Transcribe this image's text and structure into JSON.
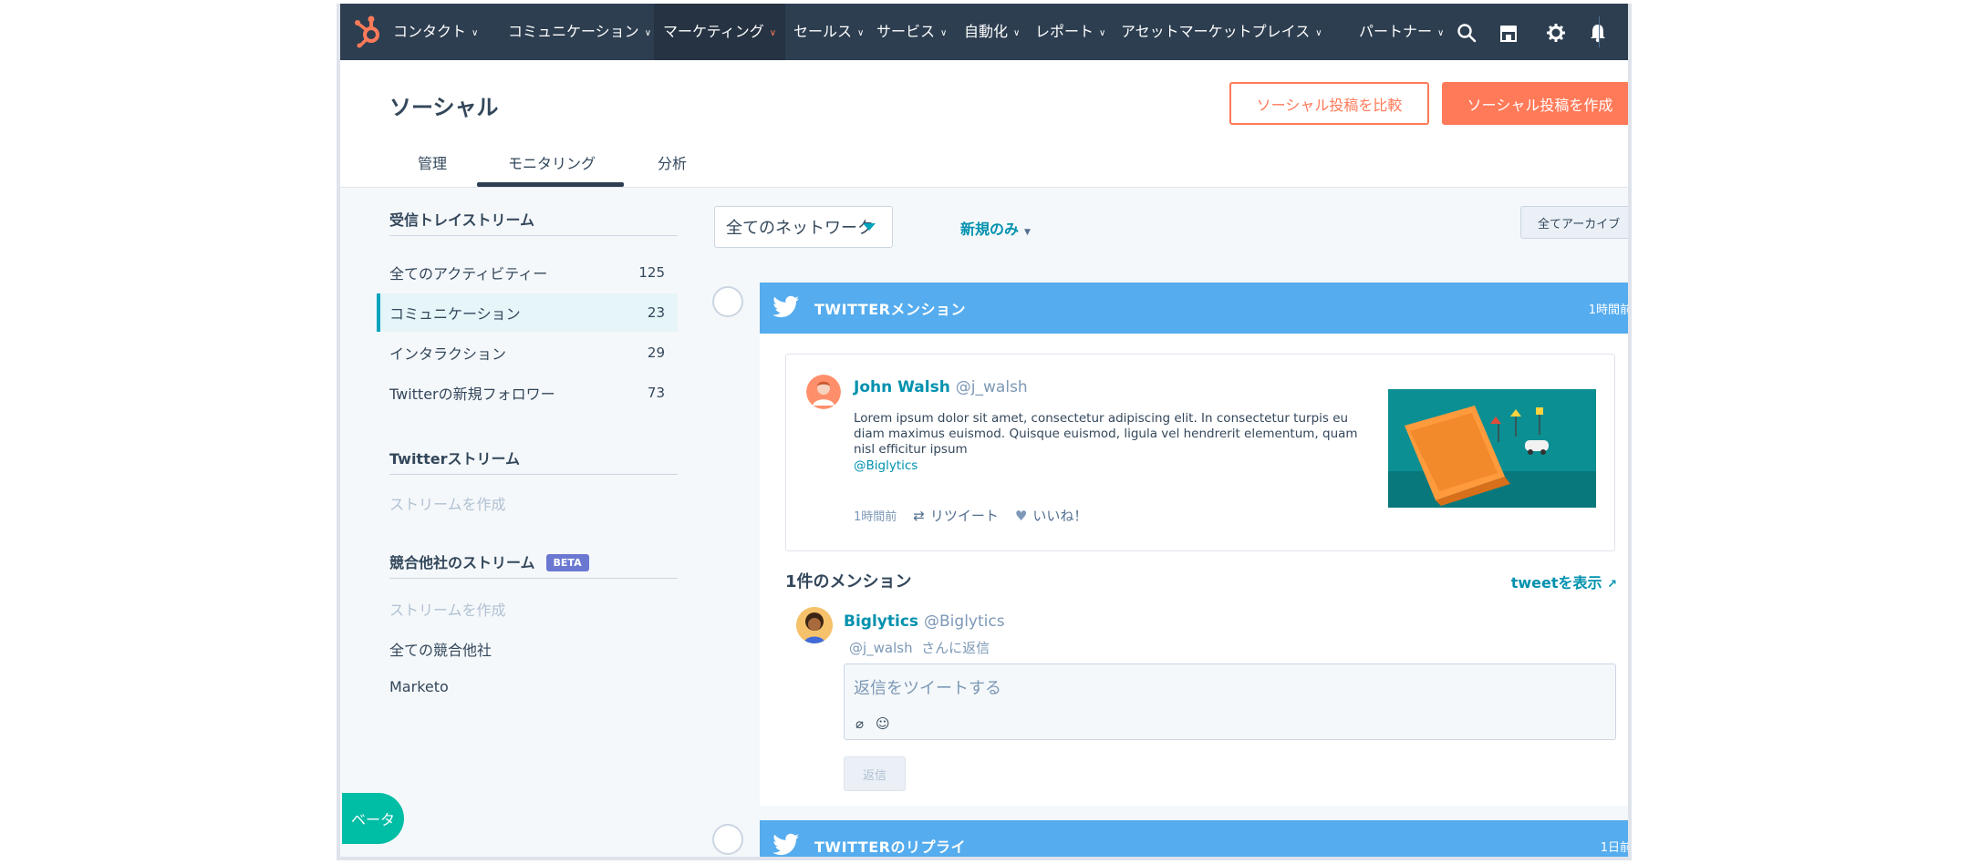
{
  "nav": {
    "items": [
      {
        "label": "コンタクト",
        "active": false
      },
      {
        "label": "コミュニケーション",
        "active": false
      },
      {
        "label": "マーケティング",
        "active": true
      },
      {
        "label": "セールス",
        "active": false
      },
      {
        "label": "サービス",
        "active": false
      },
      {
        "label": "自動化",
        "active": false
      },
      {
        "label": "レポート",
        "active": false
      },
      {
        "label": "アセットマーケットプレイス",
        "active": false
      },
      {
        "label": "パートナー",
        "active": false
      }
    ],
    "icons": [
      "hubspot-logo-icon",
      "search-icon",
      "marketplace-icon",
      "gear-icon",
      "bell-icon"
    ],
    "colors": {
      "bar": "#2d3e50",
      "accent": "#ff7a59"
    }
  },
  "header": {
    "title": "ソーシャル",
    "compare_label": "ソーシャル投稿を比較",
    "create_label": "ソーシャル投稿を作成",
    "tabs": [
      "管理",
      "モニタリング",
      "分析"
    ],
    "active_tab": "モニタリング"
  },
  "sidebar": {
    "inbox_heading": "受信トレイストリーム",
    "inbox_items": [
      {
        "label": "全てのアクティビティー",
        "count": "125"
      },
      {
        "label": "コミュニケーション",
        "count": "23"
      },
      {
        "label": "インタラクション",
        "count": "29"
      },
      {
        "label": "Twitterの新規フォロワー",
        "count": "73"
      }
    ],
    "twitter_heading": "Twitterストリーム",
    "twitter_create": "ストリームを作成",
    "competitor_heading": "競合他社のストリーム",
    "competitor_badge": "BETA",
    "competitor_create": "ストリームを作成",
    "competitor_items": [
      "全ての競合他社",
      "Marketo"
    ],
    "beta_float": "ベータ"
  },
  "filters": {
    "network_value": "全てのネットワーク",
    "new_only": "新規のみ",
    "archive_all": "全てアーカイブ"
  },
  "streams": [
    {
      "title": "TWITTERメンション",
      "time": "1時間前",
      "color": "#55acee"
    },
    {
      "title": "TWITTERのリプライ",
      "time": "1日前",
      "color": "#55acee"
    }
  ],
  "tweet": {
    "name": "John Walsh",
    "handle": "@j_walsh",
    "text": "Lorem ipsum dolor sit amet, consectetur adipiscing elit. In consectetur turpis eu diam maximus euismod. Quisque euismod, ligula vel hendrerit elementum, quam nisl efficitur ipsum",
    "mention": "@Biglytics",
    "time": "1時間前",
    "retweet": "リツイート",
    "like": "いいね！"
  },
  "mentions": {
    "count_label": "1件のメンション",
    "show_tweet": "tweetを表示"
  },
  "reply": {
    "name": "Biglytics",
    "handle": "@Biglytics",
    "reply_to_handle": "@j_walsh",
    "reply_to_suffix": "さんに返信",
    "placeholder": "返信をツイートする",
    "button": "返信"
  }
}
